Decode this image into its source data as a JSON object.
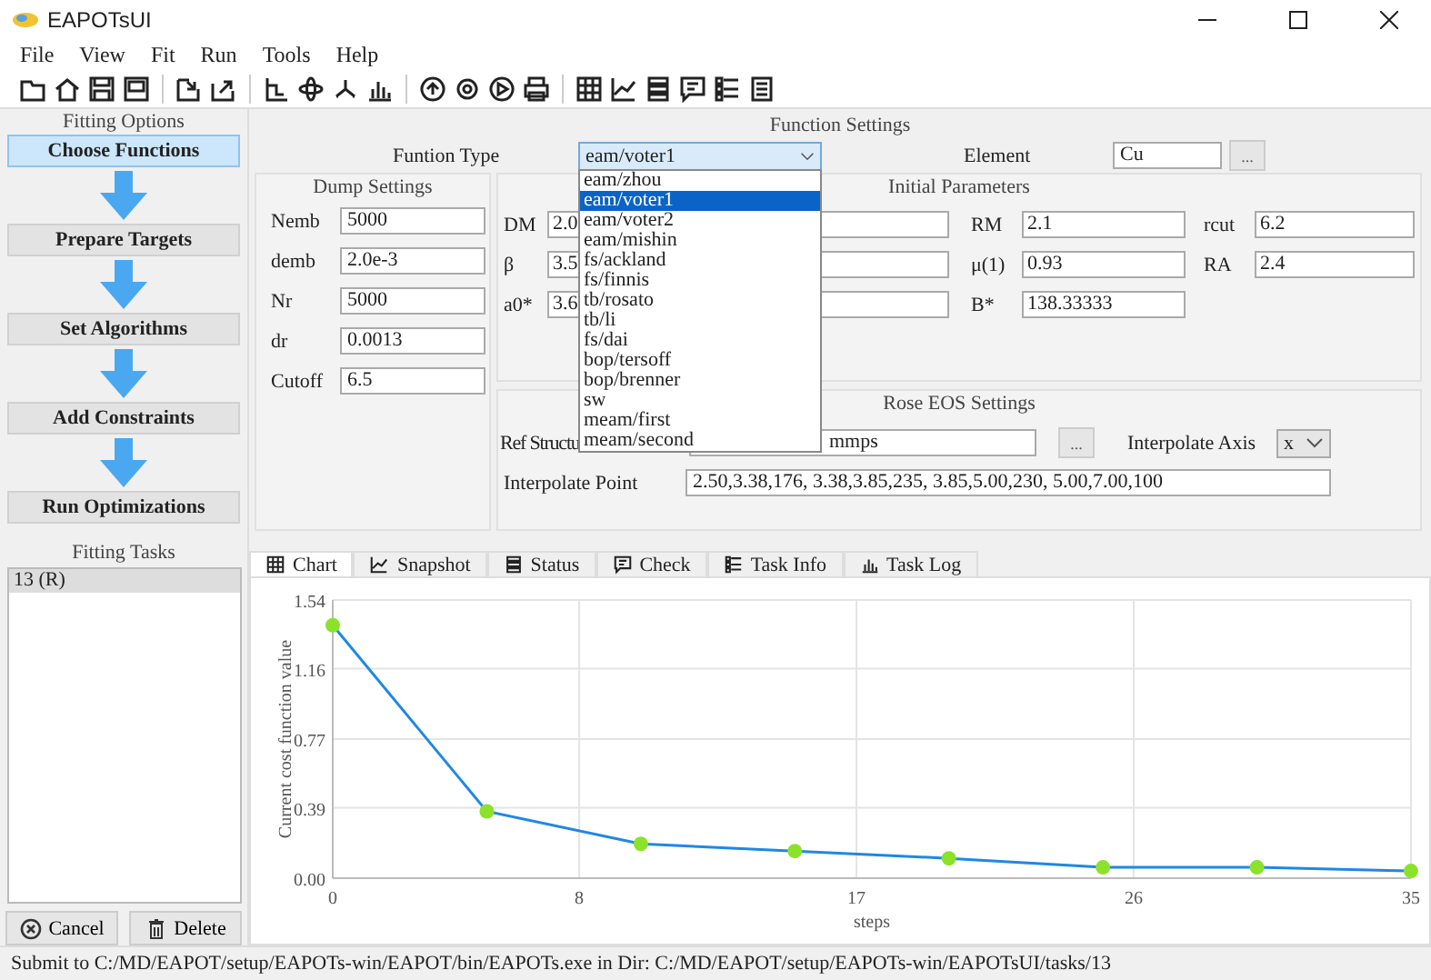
{
  "window": {
    "title": "EAPOTsUI"
  },
  "menu": [
    "File",
    "View",
    "Fit",
    "Run",
    "Tools",
    "Help"
  ],
  "fitting_options": {
    "title": "Fitting Options",
    "steps": [
      {
        "label": "Choose Functions",
        "selected": true
      },
      {
        "label": "Prepare Targets",
        "selected": false
      },
      {
        "label": "Set Algorithms",
        "selected": false
      },
      {
        "label": "Add Constraints",
        "selected": false
      },
      {
        "label": "Run Optimizations",
        "selected": false
      }
    ]
  },
  "fitting_tasks": {
    "title": "Fitting Tasks",
    "items": [
      {
        "label": "13 (R)",
        "selected": true
      }
    ],
    "buttons": [
      "Cancel",
      "Delete"
    ]
  },
  "function_settings": {
    "title": "Function Settings",
    "function_type": {
      "label": "Funtion Type",
      "value": "eam/voter1",
      "expanded": true,
      "options": [
        {
          "label": "eam/zhou",
          "selected": false
        },
        {
          "label": "eam/voter1",
          "selected": true
        },
        {
          "label": "eam/voter2",
          "selected": false
        },
        {
          "label": "eam/mishin",
          "selected": false
        },
        {
          "label": "fs/ackland",
          "selected": false
        },
        {
          "label": "fs/finnis",
          "selected": false
        },
        {
          "label": "tb/rosato",
          "selected": false
        },
        {
          "label": "tb/li",
          "selected": false
        },
        {
          "label": "fs/dai",
          "selected": false
        },
        {
          "label": "bop/tersoff",
          "selected": false
        },
        {
          "label": "bop/brenner",
          "selected": false
        },
        {
          "label": "sw",
          "selected": false
        },
        {
          "label": "meam/first",
          "selected": false
        },
        {
          "label": "meam/second",
          "selected": false
        }
      ]
    },
    "element": {
      "label": "Element",
      "value": "Cu",
      "button": "..."
    },
    "dump_settings": {
      "title": "Dump Settings",
      "fields": [
        {
          "label": "Nemb",
          "value": "5000"
        },
        {
          "label": "demb",
          "value": "2.0e-3"
        },
        {
          "label": "Nr",
          "value": "5000"
        },
        {
          "label": "dr",
          "value": "0.0013"
        },
        {
          "label": "Cutoff",
          "value": "6.5"
        }
      ]
    },
    "initial_parameters": {
      "title": "Initial Parameters",
      "fields": [
        {
          "label": "DM",
          "value": "2.0"
        },
        {
          "label": "RM",
          "value": "2.1"
        },
        {
          "label": "rcut",
          "value": "6.2"
        },
        {
          "label": "β",
          "value": "3.5"
        },
        {
          "label": "μ(1)",
          "value": "0.93"
        },
        {
          "label": "RA",
          "value": "2.4"
        },
        {
          "label": "a0*",
          "value": "3.6"
        },
        {
          "label": "B*",
          "value": "138.33333"
        }
      ]
    },
    "rose_eos": {
      "title": "Rose EOS Settings",
      "ref_structure": {
        "label": "Ref Structu",
        "value": "mmps",
        "button": "..."
      },
      "interpolate_axis": {
        "label": "Interpolate Axis",
        "value": "x"
      },
      "interpolate_point": {
        "label": "Interpolate Point",
        "value": "2.50,3.38,176, 3.38,3.85,235, 3.85,5.00,230, 5.00,7.00,100"
      }
    }
  },
  "tabs": [
    {
      "label": "Chart",
      "selected": true
    },
    {
      "label": "Snapshot",
      "selected": false
    },
    {
      "label": "Status",
      "selected": false
    },
    {
      "label": "Check",
      "selected": false
    },
    {
      "label": "Task Info",
      "selected": false
    },
    {
      "label": "Task Log",
      "selected": false
    }
  ],
  "chart_data": {
    "type": "line",
    "xlabel": "steps",
    "ylabel": "Current cost function value",
    "x": [
      0,
      5,
      10,
      15,
      20,
      25,
      30,
      35
    ],
    "grid": true,
    "series": [
      {
        "color": "#1e88e5",
        "marker": "circle",
        "values": [
          1.4,
          0.37,
          0.19,
          0.15,
          0.11,
          0.06,
          0.06,
          0.04
        ]
      }
    ],
    "xlim": [
      0,
      35
    ],
    "ylim": [
      0,
      1.54
    ],
    "xticks": [
      0,
      8,
      17,
      26,
      35
    ],
    "yticks": [
      {
        "value": 0,
        "label": "0.00"
      },
      {
        "value": 0.39,
        "label": "0.39"
      },
      {
        "value": 0.77,
        "label": "0.77"
      },
      {
        "value": 1.16,
        "label": "1.16"
      },
      {
        "value": 1.54,
        "label": "1.54"
      }
    ]
  },
  "status_bar": "Submit to C:/MD/EAPOT/setup/EAPOTs-win/EAPOT/bin/EAPOTs.exe in Dir: C:/MD/EAPOT/setup/EAPOTs-win/EAPOTsUI/tasks/13"
}
